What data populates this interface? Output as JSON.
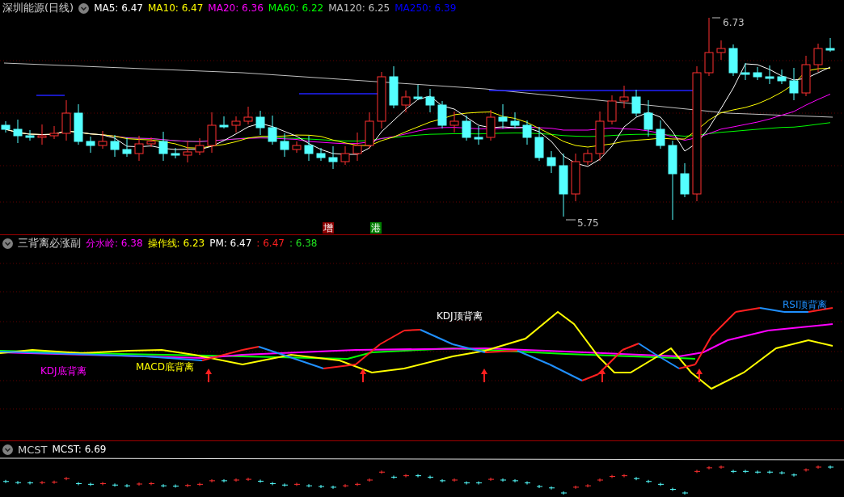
{
  "main_chart": {
    "title": "深圳能源(日线)",
    "legend": [
      {
        "label": "MA5: 6.47",
        "color": "#ffffff"
      },
      {
        "label": "MA10: 6.47",
        "color": "#ffff00"
      },
      {
        "label": "MA20: 6.36",
        "color": "#ff00ff"
      },
      {
        "label": "MA60: 6.22",
        "color": "#00ff00"
      },
      {
        "label": "MA120: 6.25",
        "color": "#c0c0c0"
      },
      {
        "label": "MA250: 6.39",
        "color": "#0000ff"
      }
    ],
    "high_label": "6.73",
    "low_label": "5.75",
    "badges": [
      {
        "text": "增",
        "color": "#8b0000"
      },
      {
        "text": "港",
        "color": "#008000"
      }
    ]
  },
  "indicator_panel": {
    "title": "三背离必涨副",
    "legend": [
      {
        "label": "分水岭: 6.38",
        "color": "#ff00ff"
      },
      {
        "label": "操作线: 6.23",
        "color": "#ffff00"
      },
      {
        "label": "PM: 6.47",
        "color": "#ffffff"
      },
      {
        "label": ": 6.47",
        "color": "#ff2020"
      },
      {
        "label": ": 6.38",
        "color": "#20e020"
      }
    ],
    "annotations": [
      {
        "text": "KDJ顶背离",
        "color": "#ffffff"
      },
      {
        "text": "RSI顶背离",
        "color": "#1e90ff"
      },
      {
        "text": "KDJ底背离",
        "color": "#ff00ff"
      },
      {
        "text": "MACD底背离",
        "color": "#ffff00"
      }
    ]
  },
  "mcst_panel": {
    "title": "MCST",
    "legend": [
      {
        "label": "MCST: 6.69",
        "color": "#ffffff"
      }
    ]
  }
}
